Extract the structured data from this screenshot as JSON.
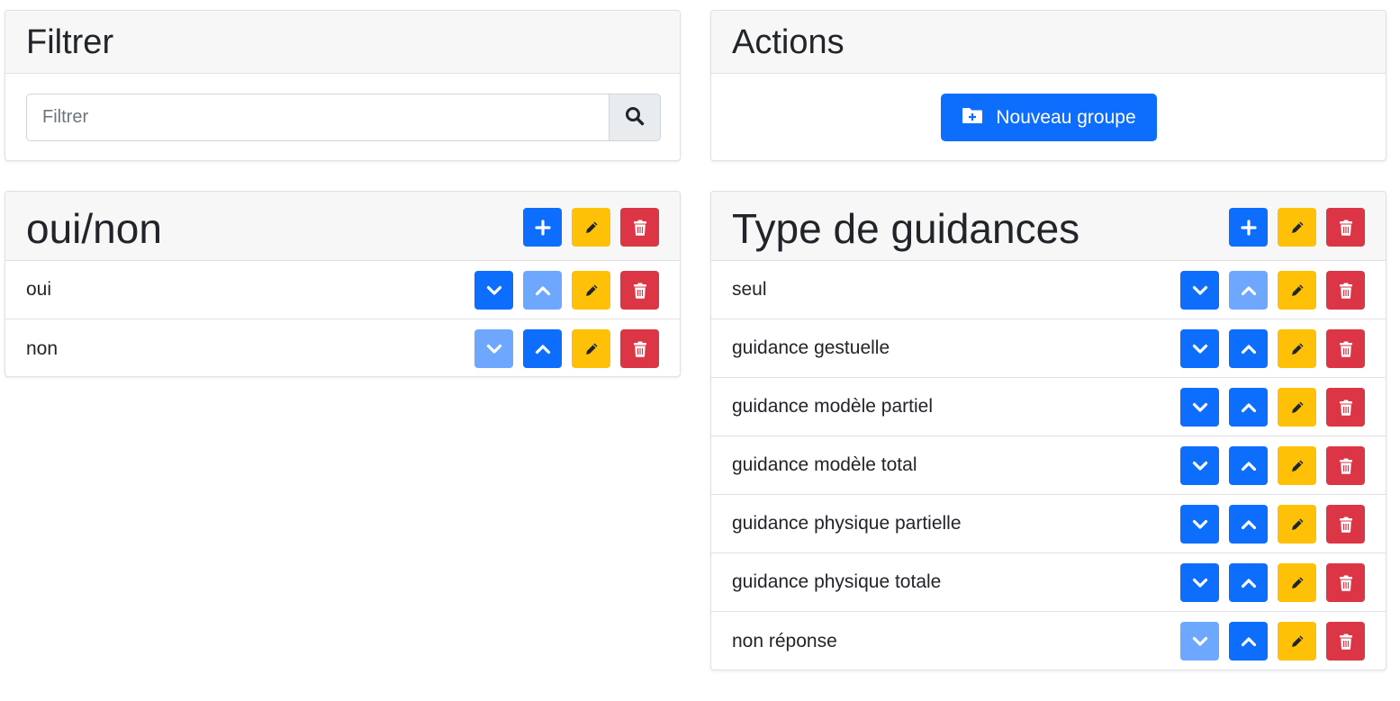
{
  "filter": {
    "title": "Filtrer",
    "placeholder": "Filtrer",
    "value": ""
  },
  "actions": {
    "title": "Actions",
    "new_group_label": "Nouveau groupe"
  },
  "groups": [
    {
      "title": "oui/non",
      "items": [
        {
          "label": "oui",
          "down_enabled": true,
          "up_enabled": false
        },
        {
          "label": "non",
          "down_enabled": false,
          "up_enabled": true
        }
      ]
    },
    {
      "title": "Type de guidances",
      "items": [
        {
          "label": "seul",
          "down_enabled": true,
          "up_enabled": false
        },
        {
          "label": "guidance gestuelle",
          "down_enabled": true,
          "up_enabled": true
        },
        {
          "label": "guidance modèle partiel",
          "down_enabled": true,
          "up_enabled": true
        },
        {
          "label": "guidance modèle total",
          "down_enabled": true,
          "up_enabled": true
        },
        {
          "label": "guidance physique partielle",
          "down_enabled": true,
          "up_enabled": true
        },
        {
          "label": "guidance physique totale",
          "down_enabled": true,
          "up_enabled": true
        },
        {
          "label": "non réponse",
          "down_enabled": false,
          "up_enabled": true
        }
      ]
    }
  ],
  "icons": {
    "search": "search-icon",
    "new_folder": "folder-plus-icon",
    "add": "plus-icon",
    "edit": "pencil-icon",
    "delete": "trash-icon",
    "down": "chevron-down-icon",
    "up": "chevron-up-icon"
  },
  "colors": {
    "primary": "#0d6efd",
    "primary_disabled": "#6ea8fe",
    "warning": "#ffc107",
    "danger": "#dc3545",
    "header_bg": "#f7f7f8"
  }
}
